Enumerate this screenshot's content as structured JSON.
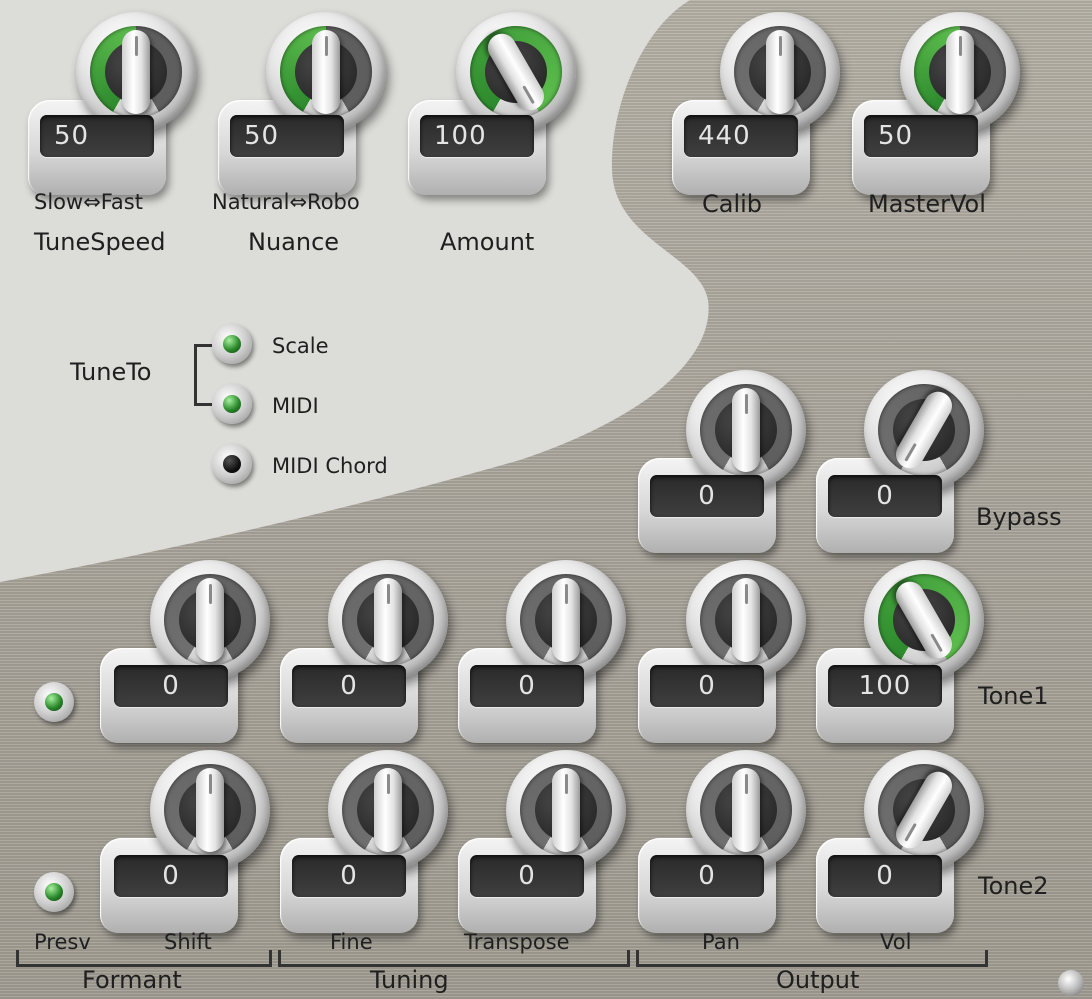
{
  "top_knobs": [
    {
      "id": "tunespeed",
      "value": "50",
      "range_label": "Slow⇔Fast",
      "label": "TuneSpeed",
      "level": 0.5,
      "accent": "#2e8b2e"
    },
    {
      "id": "nuance",
      "value": "50",
      "range_label": "Natural⇔Robo",
      "label": "Nuance",
      "level": 0.5,
      "accent": "#2e8b2e"
    },
    {
      "id": "amount",
      "value": "100",
      "range_label": "",
      "label": "Amount",
      "level": 1.0,
      "accent": "#2e8b2e"
    },
    {
      "id": "calib",
      "value": "440",
      "range_label": "",
      "label": "Calib",
      "level": 0.5,
      "accent": ""
    },
    {
      "id": "mastervol",
      "value": "50",
      "range_label": "",
      "label": "MasterVol",
      "level": 0.5,
      "accent": "#2e8b2e"
    }
  ],
  "tune_to": {
    "label": "TuneTo",
    "options": [
      {
        "label": "Scale",
        "state": "on"
      },
      {
        "label": "MIDI",
        "state": "on"
      },
      {
        "label": "MIDI Chord",
        "state": "off"
      }
    ]
  },
  "bypass": {
    "label": "Bypass",
    "knobs": [
      {
        "value": "0",
        "level": 0.5
      },
      {
        "value": "0",
        "level": 0.0
      }
    ]
  },
  "tone1": {
    "label": "Tone1",
    "knobs": [
      {
        "value": "0",
        "level": 0.5
      },
      {
        "value": "0",
        "level": 0.5
      },
      {
        "value": "0",
        "level": 0.5
      },
      {
        "value": "0",
        "level": 0.5
      },
      {
        "value": "100",
        "level": 1.0
      }
    ]
  },
  "tone2": {
    "label": "Tone2",
    "knobs": [
      {
        "value": "0",
        "level": 0.5
      },
      {
        "value": "0",
        "level": 0.5
      },
      {
        "value": "0",
        "level": 0.5
      },
      {
        "value": "0",
        "level": 0.5
      },
      {
        "value": "0",
        "level": 0.0
      }
    ]
  },
  "columns": {
    "presv": "Presv",
    "shift": "Shift",
    "fine": "Fine",
    "transpose": "Transpose",
    "pan": "Pan",
    "vol": "Vol"
  },
  "groups": {
    "formant": "Formant",
    "tuning": "Tuning",
    "output": "Output"
  },
  "colors": {
    "accent": "#2e8b2e",
    "panel": "#aba79d",
    "swoosh": "#dcdcd8"
  }
}
